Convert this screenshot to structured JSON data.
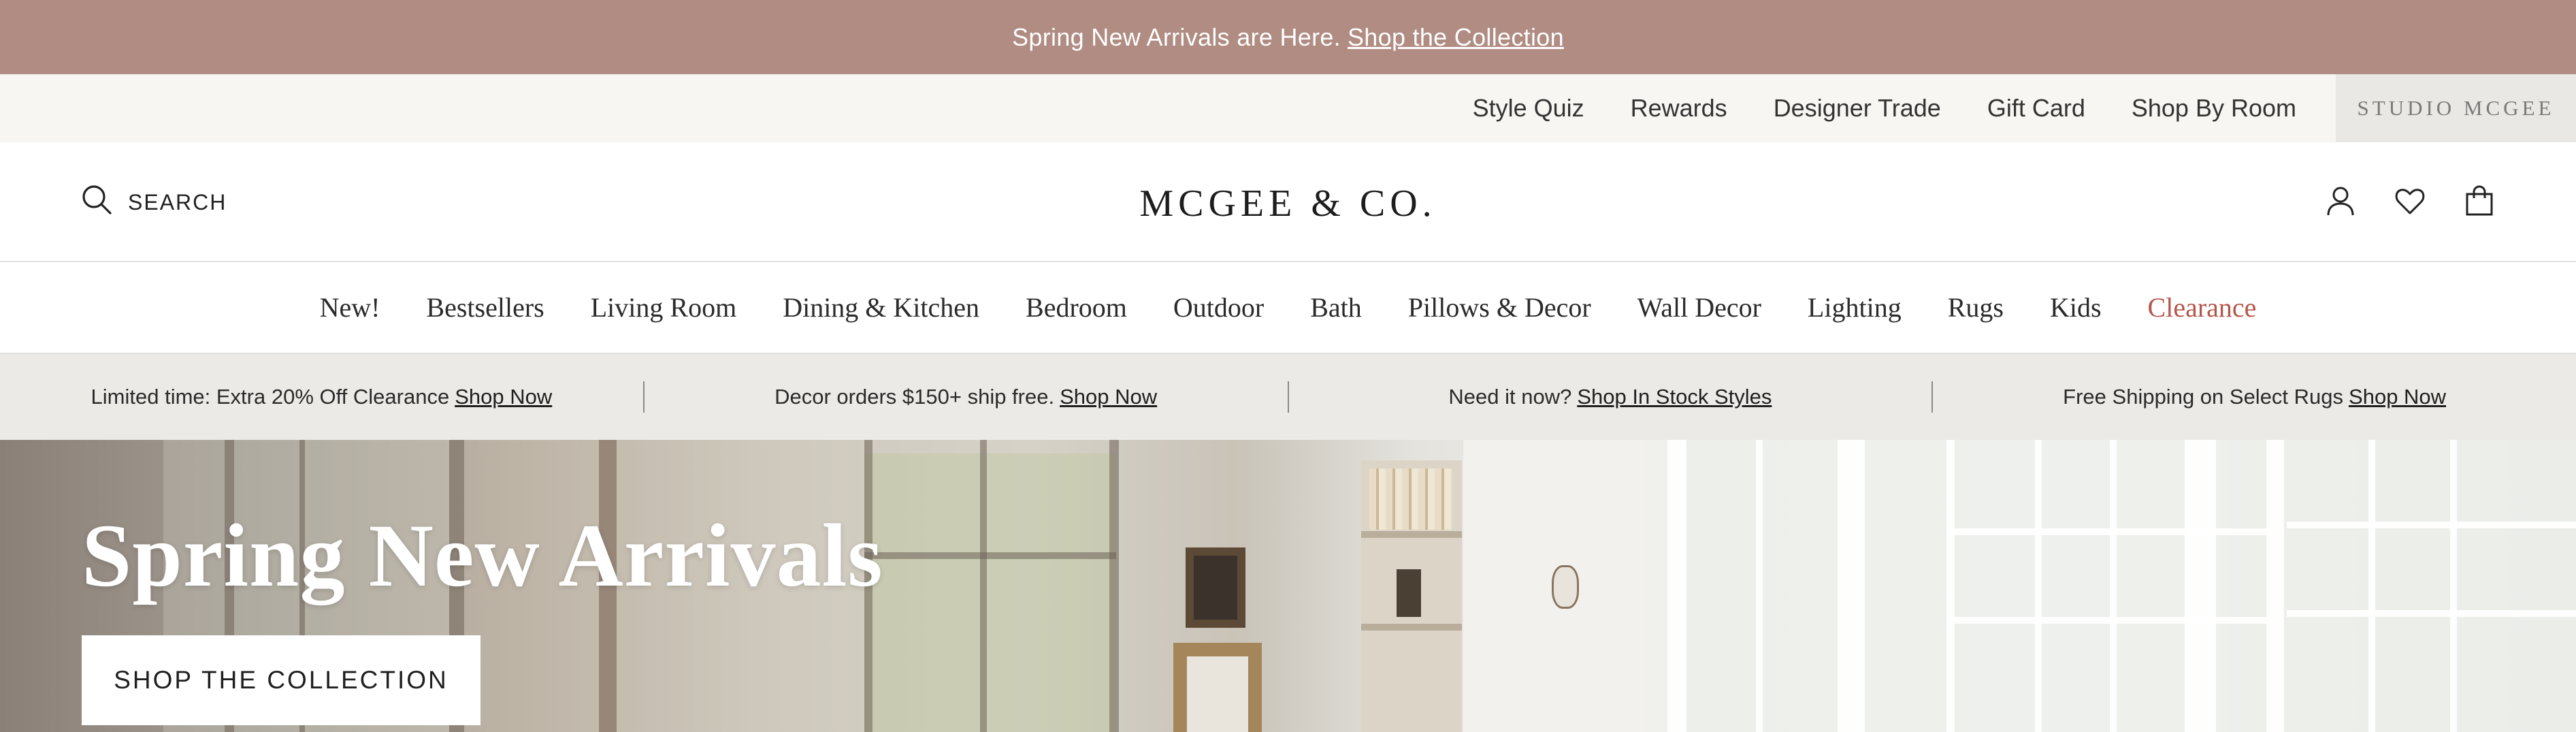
{
  "announcement": {
    "text": "Spring New Arrivals are Here.",
    "link": "Shop the Collection"
  },
  "utility_nav": {
    "links": [
      "Style Quiz",
      "Rewards",
      "Designer Trade",
      "Gift Card",
      "Shop By Room"
    ],
    "studio": "STUDIO MCGEE"
  },
  "header": {
    "search_label": "SEARCH",
    "logo": "MCGEE & CO.",
    "icons": [
      "account-icon",
      "heart-icon",
      "shopping-bag-icon"
    ]
  },
  "category_nav": {
    "items": [
      "New!",
      "Bestsellers",
      "Living Room",
      "Dining & Kitchen",
      "Bedroom",
      "Outdoor",
      "Bath",
      "Pillows & Decor",
      "Wall Decor",
      "Lighting",
      "Rugs",
      "Kids",
      "Clearance"
    ],
    "highlight_color": "#b4574b"
  },
  "promo_strip": [
    {
      "text": "Limited time: Extra 20% Off Clearance",
      "link": "Shop Now"
    },
    {
      "text": "Decor orders $150+ ship free.",
      "link": "Shop Now"
    },
    {
      "text": "Need it now?",
      "link": "Shop In Stock Styles"
    },
    {
      "text": "Free Shipping on Select Rugs",
      "link": "Shop Now"
    }
  ],
  "hero": {
    "title": "Spring New Arrivals",
    "button": "SHOP THE COLLECTION"
  },
  "colors": {
    "announcement_bg": "#b08c82",
    "utility_bg": "#f7f6f2",
    "promo_bg": "#ebeae6"
  }
}
